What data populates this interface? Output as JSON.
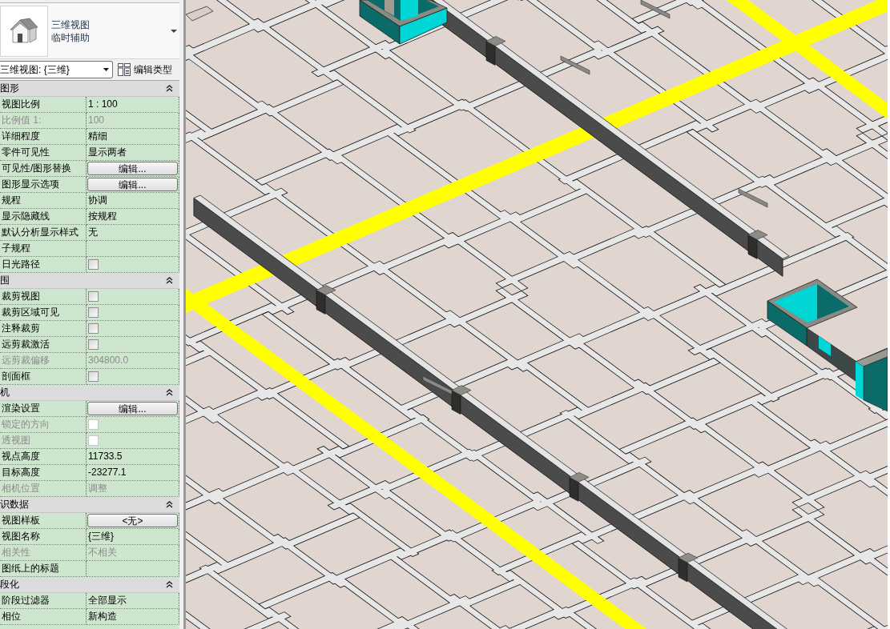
{
  "type_selector": {
    "family": "三维视图",
    "type": "临时辅助"
  },
  "view_dropdown": {
    "value": "三维视图: {三维}"
  },
  "edit_type_button": {
    "label": "编辑类型"
  },
  "sections": [
    {
      "title": "图形",
      "expanded": true,
      "rows": [
        {
          "label": "视图比例",
          "kind": "text",
          "value": "1 : 100",
          "disabled": false
        },
        {
          "label": "比例值 1:",
          "kind": "text",
          "value": "100",
          "disabled": true
        },
        {
          "label": "详细程度",
          "kind": "text",
          "value": "精细",
          "disabled": false
        },
        {
          "label": "零件可见性",
          "kind": "text",
          "value": "显示两者",
          "disabled": false
        },
        {
          "label": "可见性/图形替换",
          "kind": "button",
          "value": "编辑...",
          "disabled": false
        },
        {
          "label": "图形显示选项",
          "kind": "button",
          "value": "编辑...",
          "disabled": false
        },
        {
          "label": "规程",
          "kind": "text",
          "value": "协调",
          "disabled": false
        },
        {
          "label": "显示隐藏线",
          "kind": "text",
          "value": "按规程",
          "disabled": false
        },
        {
          "label": "默认分析显示样式",
          "kind": "text",
          "value": "无",
          "disabled": false
        },
        {
          "label": "子规程",
          "kind": "text",
          "disabled": false
        },
        {
          "label": "日光路径",
          "kind": "checkbox",
          "checked": false,
          "disabled": false
        }
      ]
    },
    {
      "title": "围",
      "expanded": true,
      "rows": [
        {
          "label": "裁剪视图",
          "kind": "checkbox",
          "checked": false,
          "disabled": false
        },
        {
          "label": "裁剪区域可见",
          "kind": "checkbox",
          "checked": false,
          "disabled": false
        },
        {
          "label": "注释裁剪",
          "kind": "checkbox",
          "checked": false,
          "disabled": false
        },
        {
          "label": "远剪裁激活",
          "kind": "checkbox",
          "checked": false,
          "disabled": false
        },
        {
          "label": "远剪裁偏移",
          "kind": "text",
          "value": "304800.0",
          "disabled": true
        },
        {
          "label": "剖面框",
          "kind": "checkbox",
          "checked": false,
          "disabled": false
        }
      ]
    },
    {
      "title": "机",
      "expanded": true,
      "rows": [
        {
          "label": "渲染设置",
          "kind": "button",
          "value": "编辑...",
          "disabled": false
        },
        {
          "label": "锁定的方向",
          "kind": "checkbox",
          "checked": false,
          "disabled": true
        },
        {
          "label": "透视图",
          "kind": "checkbox",
          "checked": false,
          "disabled": true
        },
        {
          "label": "视点高度",
          "kind": "text",
          "value": "11733.5",
          "disabled": false
        },
        {
          "label": "目标高度",
          "kind": "text",
          "value": "-23277.1",
          "disabled": false
        },
        {
          "label": "相机位置",
          "kind": "text",
          "value": "调整",
          "disabled": true
        }
      ]
    },
    {
      "title": "识数据",
      "expanded": true,
      "rows": [
        {
          "label": "视图样板",
          "kind": "button",
          "value": "<无>",
          "disabled": false
        },
        {
          "label": "视图名称",
          "kind": "text",
          "value": "{三维}",
          "disabled": false
        },
        {
          "label": "相关性",
          "kind": "text",
          "value": "不相关",
          "disabled": true
        },
        {
          "label": "图纸上的标题",
          "kind": "text",
          "disabled": false
        }
      ]
    },
    {
      "title": "段化",
      "expanded": true,
      "rows": [
        {
          "label": "阶段过滤器",
          "kind": "text",
          "value": "全部显示",
          "disabled": false
        },
        {
          "label": "相位",
          "kind": "text",
          "value": "新构造",
          "disabled": false
        }
      ]
    }
  ]
}
